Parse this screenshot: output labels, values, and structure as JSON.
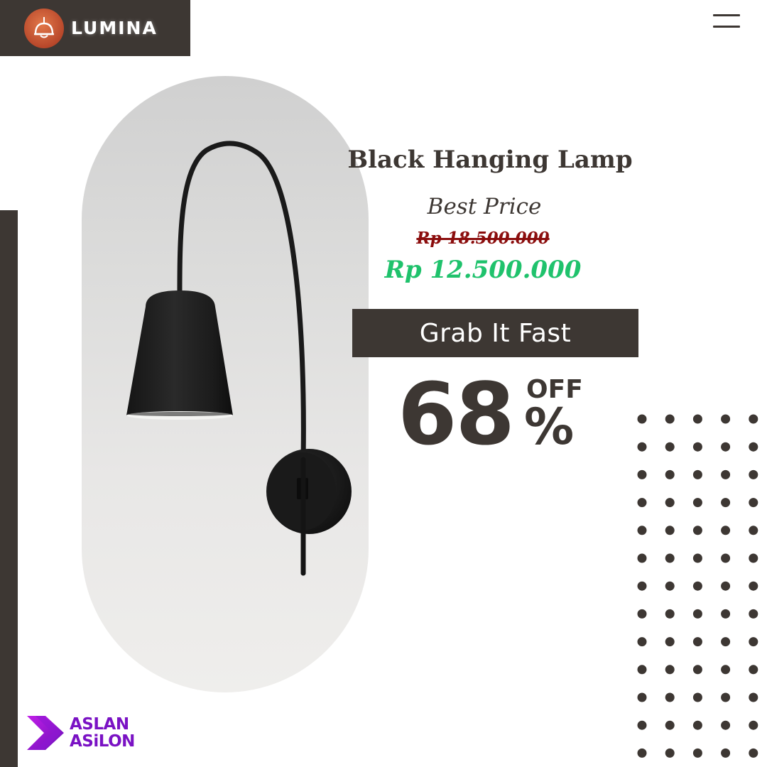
{
  "brand": {
    "name": "LUMINA",
    "logo_icon": "pendant-lamp-icon",
    "bar_color": "#3d3733",
    "logo_color": "#c9542f"
  },
  "menu": {
    "icon": "hamburger-menu-icon"
  },
  "product": {
    "title": "Black Hanging Lamp",
    "price_label": "Best Price",
    "old_price": "Rp 18.500.000",
    "new_price": "Rp 12.500.000",
    "image": "black-wall-lamp-photo"
  },
  "cta": {
    "label": "Grab It Fast"
  },
  "discount": {
    "value": "68",
    "off_label": "OFF",
    "percent_sign": "%"
  },
  "partner": {
    "line1": "ASLAN",
    "line2": "ASiLON",
    "icon": "chevron-arrow-icon"
  },
  "colors": {
    "dark": "#3d3733",
    "old_price": "#8b0d0d",
    "new_price": "#1fc26c",
    "partner": "#7a12c4",
    "background": "#ffffff"
  }
}
